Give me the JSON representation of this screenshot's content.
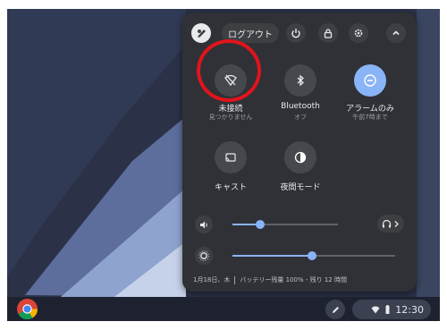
{
  "tray": {
    "sign_out_label": "ログアウト",
    "top_icons": [
      "power-icon",
      "lock-icon",
      "gear-icon",
      "collapse-chevron-icon"
    ]
  },
  "tiles": [
    {
      "id": "network",
      "label": "未接続",
      "sublabel": "見つかりません",
      "icon": "wifi-off-icon",
      "active": false
    },
    {
      "id": "bluetooth",
      "label": "Bluetooth",
      "sublabel": "オフ",
      "icon": "bluetooth-icon",
      "active": false
    },
    {
      "id": "notifications",
      "label": "アラームのみ",
      "sublabel": "午前7時まで",
      "icon": "do-not-disturb-icon",
      "active": true
    },
    {
      "id": "cast",
      "label": "キャスト",
      "sublabel": "",
      "icon": "cast-icon",
      "active": false
    },
    {
      "id": "night-light",
      "label": "夜間モード",
      "sublabel": "",
      "icon": "night-light-icon",
      "active": false
    }
  ],
  "sliders": {
    "volume": {
      "value_fraction": 0.26,
      "icon": "volume-icon"
    },
    "brightness": {
      "value_fraction": 0.49,
      "icon": "brightness-icon"
    }
  },
  "footer": {
    "date": "1月18日、木",
    "battery": "バッテリー残量 100% - 残り 12 時間"
  },
  "shelf": {
    "time": "12:30",
    "icons": [
      "chrome-icon",
      "stylus-icon",
      "wifi-icon",
      "battery-icon"
    ]
  },
  "colors": {
    "accent": "#8ab4f8",
    "highlight_circle": "#e0141c",
    "panel": "#2f3136"
  }
}
